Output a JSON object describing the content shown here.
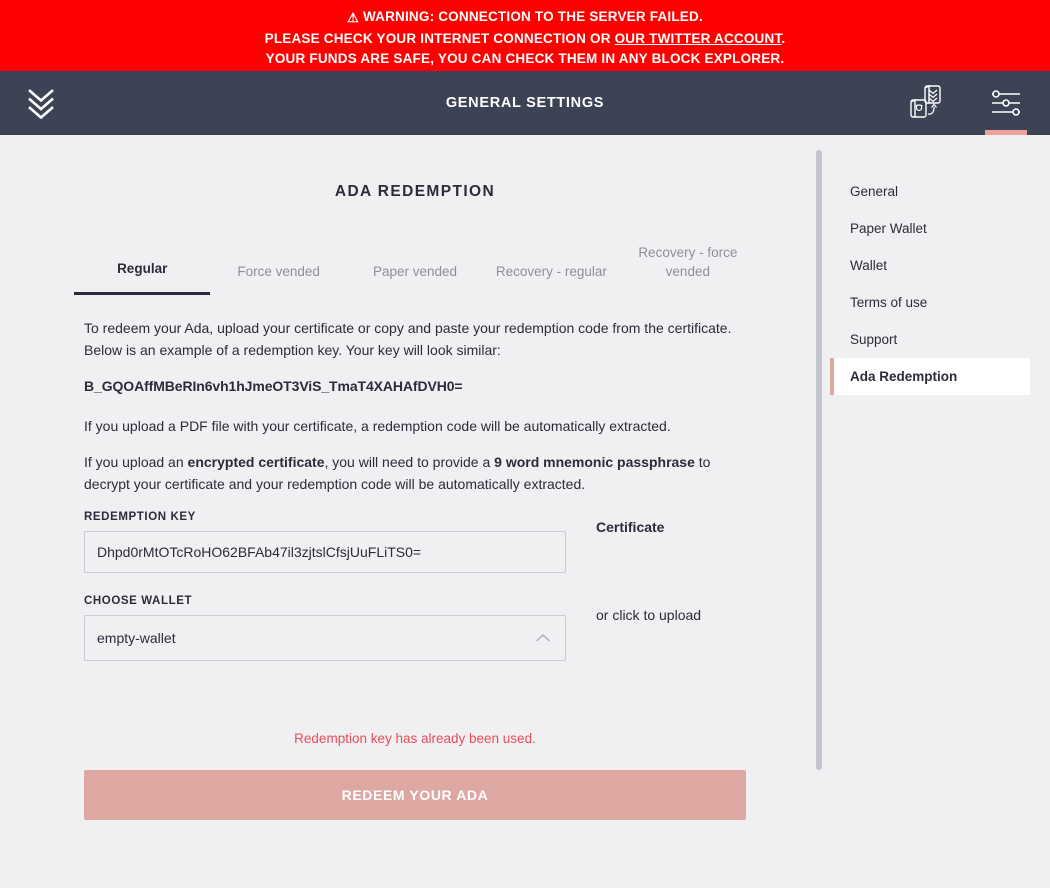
{
  "warning": {
    "icon": "warning-triangle-icon",
    "line1": "WARNING: CONNECTION TO THE SERVER FAILED.",
    "line2_before": "PLEASE CHECK YOUR INTERNET CONNECTION OR ",
    "line2_link": "OUR TWITTER ACCOUNT",
    "line2_after": ".",
    "line3": "YOUR FUNDS ARE SAFE, YOU CAN CHECK THEM IN ANY BLOCK EXPLORER.",
    "background_color": "#ff0000",
    "text_color": "#ffffff"
  },
  "topbar": {
    "logo_icon": "daedalus-chevrons-logo-icon",
    "title": "GENERAL SETTINGS",
    "wallet_switch_icon": "wallet-switch-icon",
    "settings_icon": "settings-sliders-icon",
    "background_color": "#3c4355",
    "active_indicator_color": "#eda19a"
  },
  "main": {
    "page_title": "ADA REDEMPTION",
    "tabs": [
      {
        "label": "Regular",
        "active": true
      },
      {
        "label": "Force vended",
        "active": false
      },
      {
        "label": "Paper vended",
        "active": false
      },
      {
        "label": "Recovery - regular",
        "active": false
      },
      {
        "label": "Recovery - force vended",
        "active": false
      }
    ],
    "paragraphs": [
      "To redeem your Ada, upload your certificate or copy and paste your redemption code from the certificate. Below is an example of a redemption key. Your key will look similar:"
    ],
    "key_example": "B_GQOAffMBeRIn6vh1hJmeOT3ViS_TmaT4XAHAfDVH0=",
    "paragraph_pdf": "If you upload a PDF file with your certificate, a redemption code will be automatically extracted.",
    "paragraph_encrypted": {
      "part1": "If you upload an ",
      "bold1": "encrypted certificate",
      "part2": ", you will need to provide a ",
      "bold2": "9 word mnemonic passphrase",
      "part3": " to decrypt your certificate and your redemption code will be automatically extracted."
    },
    "form": {
      "redemption_key_label": "REDEMPTION KEY",
      "redemption_key_value": "Dhpd0rMtOTcRoHO62BFAb47il3zjtslCfsjUuFLiTS0=",
      "redemption_key_placeholder": "",
      "choose_wallet_label": "CHOOSE WALLET",
      "choose_wallet_value": "empty-wallet",
      "choose_wallet_caret_icon": "chevron-up-icon",
      "certificate_label": "Certificate",
      "certificate_upload_text": "or click to upload"
    },
    "error_message": "Redemption key has already been used.",
    "error_color": "#ea4c5b",
    "submit_label": "REDEEM YOUR ADA",
    "submit_color": "#dda8a2"
  },
  "settings_menu": {
    "items": [
      {
        "label": "General",
        "active": false
      },
      {
        "label": "Paper Wallet",
        "active": false
      },
      {
        "label": "Wallet",
        "active": false
      },
      {
        "label": "Terms of use",
        "active": false
      },
      {
        "label": "Support",
        "active": false
      },
      {
        "label": "Ada Redemption",
        "active": true
      }
    ],
    "active_marker_color": "#dda8a2"
  }
}
